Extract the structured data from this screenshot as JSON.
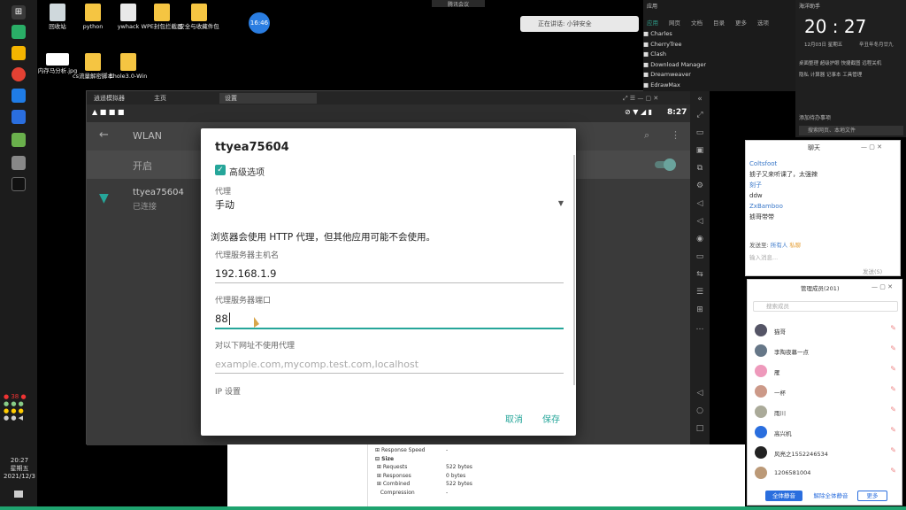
{
  "desktop": {
    "icons": [
      {
        "label": "回收站"
      },
      {
        "label": "python"
      },
      {
        "label": "ywhack"
      },
      {
        "label": "WPE封包拦截器"
      },
      {
        "label": "安全与收藏件包"
      },
      {
        "label": "内存马分析.jpg"
      },
      {
        "label": "cs流量解密脚本"
      },
      {
        "label": "Ehole3.0-Win"
      }
    ],
    "clock_badge": "16:46",
    "meeting_bar": "腾讯会议",
    "speaking": "正在讲话: 小钟安全",
    "taskbar_time": "20:27",
    "taskbar_day": "星期五",
    "taskbar_date": "2021/12/3"
  },
  "emulator": {
    "tabs": [
      {
        "label": "逍遥模拟器"
      },
      {
        "label": "主页"
      },
      {
        "label": "设置"
      }
    ],
    "status_time": "8:27",
    "screen_title": "WLAN",
    "toggle_label": "开启",
    "network_name": "ttyea75604",
    "network_status": "已连接"
  },
  "dialog": {
    "title": "ttyea75604",
    "advanced_label": "高级选项",
    "proxy_label": "代理",
    "proxy_value": "手动",
    "warning": "浏览器会使用 HTTP 代理，但其他应用可能不会使用。",
    "host_label": "代理服务器主机名",
    "host_value": "192.168.1.9",
    "port_label": "代理服务器端口",
    "port_value": "88",
    "bypass_label": "对以下网址不使用代理",
    "bypass_placeholder": "example.com,mycomp.test.com,localhost",
    "ip_label": "IP 设置",
    "cancel": "取消",
    "save": "保存"
  },
  "apps_panel": {
    "tabs": [
      "应用",
      "网页",
      "文档",
      "目录",
      "更多",
      "选项"
    ],
    "items": [
      "Charles",
      "CherryTree",
      "Clash",
      "Download Manager",
      "Dreamweaver",
      "EdrawMax"
    ]
  },
  "tray": {
    "title": "海洋助手",
    "time": "20 : 27",
    "date": "12月03日 星期五",
    "lunar": "辛丑年冬月廿九",
    "controls": [
      "桌面整理",
      "超级护眼",
      "快捷截图",
      "远程关机",
      "隐私",
      "计算器",
      "记事本",
      "工具管理"
    ],
    "search_hint": "搜索网页、本地文件",
    "task_label": "添加待办事项"
  },
  "chat": {
    "title": "聊天",
    "messages": [
      {
        "user": "Coltsfoot",
        "text": "掳子又来听课了，太强辣"
      },
      {
        "user": "刻子",
        "text": "ddw"
      },
      {
        "user": "ZxBamboo",
        "text": "掳哥带带"
      }
    ],
    "send_to": "发送至:",
    "target": "所有人",
    "private": "私聊",
    "input_placeholder": "输入消息...",
    "send_btn": "发送(S)"
  },
  "members": {
    "title": "管理成员(201)",
    "search_placeholder": "搜索成员",
    "list": [
      "猫哥",
      "李陶夜幕一点",
      "雁",
      "一杯",
      "雨川",
      "高兴机",
      "风亮之1552246534",
      "1206581004"
    ],
    "mute_all": "全体静音",
    "unmute_all": "解除全体静音",
    "more": "更多"
  },
  "devtools": {
    "rows": [
      {
        "k": "Response Speed",
        "v": "-"
      },
      {
        "k": "Size",
        "v": ""
      },
      {
        "k": "Requests",
        "v": "522 bytes"
      },
      {
        "k": "Responses",
        "v": "0 bytes"
      },
      {
        "k": "Combined",
        "v": "522 bytes"
      },
      {
        "k": "Compression",
        "v": "-"
      }
    ]
  }
}
